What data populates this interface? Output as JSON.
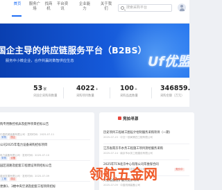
{
  "nav": {
    "items": [
      {
        "line1": "首页",
        "line2": ""
      },
      {
        "line1": "服务广",
        "line2": "场"
      },
      {
        "line1": "找商",
        "line2": "机"
      },
      {
        "line1": "平台资",
        "line2": "讯"
      },
      {
        "line1": "企业能",
        "line2": "力"
      },
      {
        "line1": "关于我",
        "line2": "们"
      }
    ],
    "search_placeholder": "搜索采购平台",
    "accent": "#1e6ef5"
  },
  "banner": {
    "title": "国企主导的供应链服务平台（B2BS）",
    "subtitle": "服务中小微企业，合作共赢的数智供应生态",
    "logo_text": "Uf优盟",
    "colors": {
      "start": "#0a3fb0",
      "end": "#2a7af0"
    }
  },
  "stats": [
    {
      "value": "53",
      "unit": "家",
      "label": "央国企采购商数量"
    },
    {
      "value": "4022",
      "unit": "+",
      "label": "采购项目数量"
    },
    {
      "value": "100",
      "unit": "+",
      "label": "采购品类数量"
    },
    {
      "value": "346859.",
      "unit": "",
      "label": "采购金额（万元）"
    }
  ],
  "left_card": {
    "items": [
      {
        "title": "购专用数控机床及配件项目招标公告",
        "tags": [
          {
            "text": "采购",
            "style": "blue"
          },
          {
            "text": "国企",
            "style": "red"
          }
        ],
        "meta": "中直机械装备有限公司 · 发布时间：2025-07-11"
      },
      {
        "title": "公司2025年电力设备采购招标项目",
        "tags": [
          {
            "text": "采购",
            "style": "blue"
          },
          {
            "text": "设备",
            "style": "red"
          }
        ],
        "meta": "电力装备有限公司 · 发布时间：2025-07-10"
      },
      {
        "title": "园区道路及配套工程建设项目招标公告",
        "tags": [
          {
            "text": "工程",
            "style": "blue"
          },
          {
            "text": "国企",
            "style": "red"
          }
        ],
        "meta": "建设发展有限公司 · 发布时间：2025-07-09"
      },
      {
        "title": "更换1、3楼中央空调及配套工程项目招标",
        "tags": [],
        "meta": ""
      }
    ]
  },
  "right_card": {
    "heading": "竞拍寻源",
    "items": [
      {
        "title": "历史项目工程竣工图设计绘制服务采购项目（一期）",
        "meta": "2025-07-15 · 中交一航局第四工程有限公司"
      },
      {
        "title": "江苏省南京市水务工程施工项目测绘服务采购",
        "meta": "2025-07-14 · 南京市水务工程建设有限公司"
      },
      {
        "title": "2025年TCN北京中心有限公司年维保合同",
        "meta": "2025-07-10 · 北京建设发展有限公司"
      },
      {
        "title": "大型设备维护服务竞价项目",
        "meta": "2025-07-09 · 中直机械装备公司"
      }
    ],
    "chip_text": "竞价中"
  },
  "watermark": "领航五金网"
}
